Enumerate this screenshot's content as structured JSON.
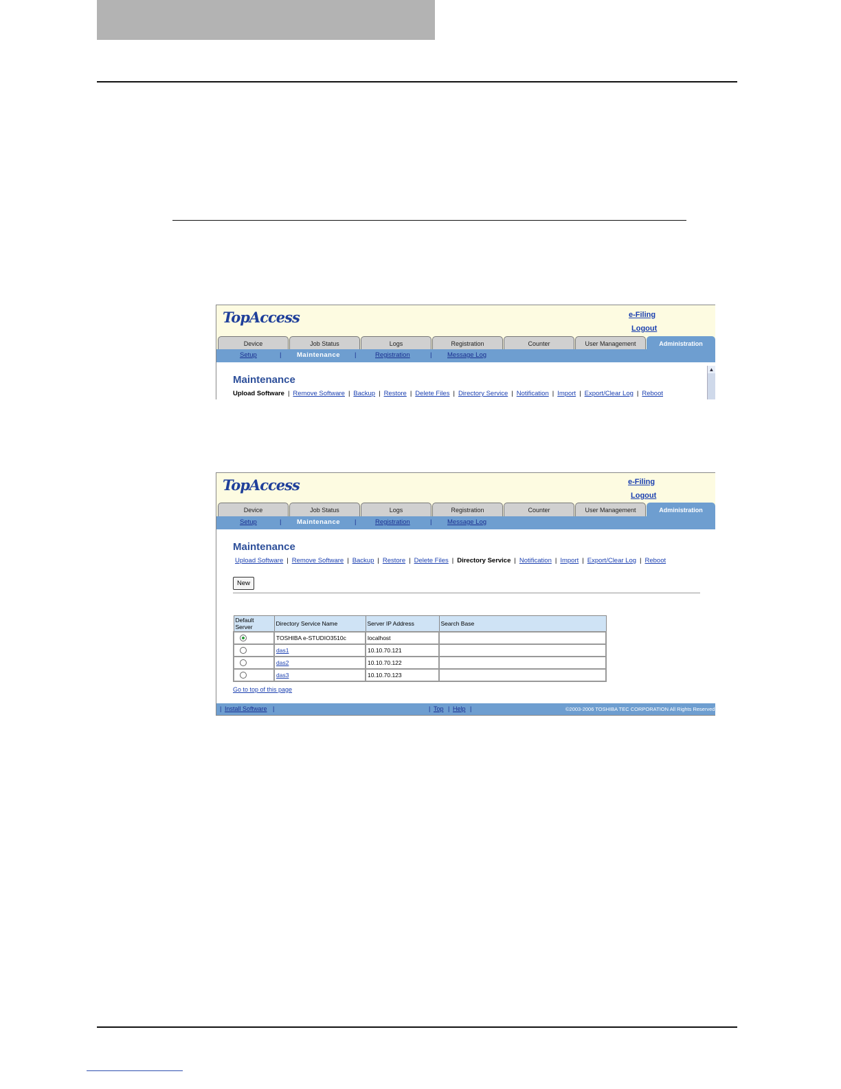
{
  "screen1": {
    "logo": "TopAccess",
    "efiling": "e-Filing",
    "logout": "Logout",
    "tabs": [
      "Device",
      "Job Status",
      "Logs",
      "Registration",
      "Counter",
      "User Management",
      "Administration"
    ],
    "subnav": [
      "Setup",
      "Maintenance",
      "Registration",
      "Message Log"
    ],
    "page_title": "Maintenance",
    "menu": [
      "Upload Software",
      "Remove Software",
      "Backup",
      "Restore",
      "Delete Files",
      "Directory Service",
      "Notification",
      "Import",
      "Export/Clear Log",
      "Reboot"
    ],
    "scroll_up": "▲"
  },
  "screen2": {
    "logo": "TopAccess",
    "efiling": "e-Filing",
    "logout": "Logout",
    "tabs": [
      "Device",
      "Job Status",
      "Logs",
      "Registration",
      "Counter",
      "User Management",
      "Administration"
    ],
    "subnav": [
      "Setup",
      "Maintenance",
      "Registration",
      "Message Log"
    ],
    "page_title": "Maintenance",
    "menu": [
      "Upload Software",
      "Remove Software",
      "Backup",
      "Restore",
      "Delete Files",
      "Directory Service",
      "Notification",
      "Import",
      "Export/Clear Log",
      "Reboot"
    ],
    "new_button": "New",
    "table": {
      "headers": [
        "Default Server",
        "Directory Service Name",
        "Server IP Address",
        "Search Base"
      ],
      "rows": [
        {
          "name": "TOSHIBA e-STUDIO3510c",
          "ip": "localhost",
          "base": ""
        },
        {
          "name": "das1",
          "ip": "10.10.70.121",
          "base": ""
        },
        {
          "name": "das2",
          "ip": "10.10.70.122",
          "base": ""
        },
        {
          "name": "das3",
          "ip": "10.10.70.123",
          "base": ""
        }
      ]
    },
    "goto_top": "Go to top of this page",
    "footer": {
      "install": "Install Software",
      "top": "Top",
      "help": "Help",
      "copyright": "©2003-2006 TOSHIBA TEC CORPORATION All Rights Reserved"
    }
  }
}
